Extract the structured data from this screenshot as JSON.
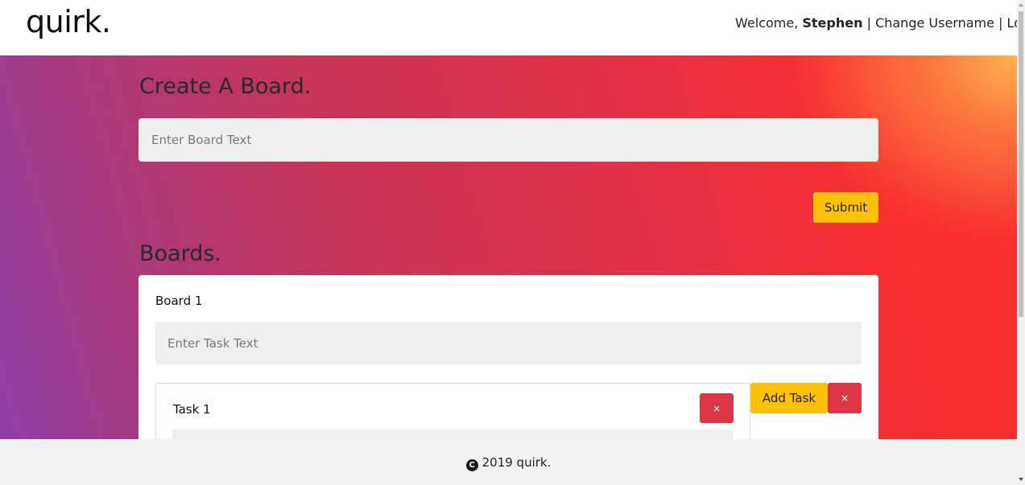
{
  "navbar": {
    "brand": "quirk.",
    "welcome_prefix": "Welcome,",
    "username": "Stephen",
    "separator": "|",
    "change_username": "Change Username",
    "logout": "Logout"
  },
  "create": {
    "heading": "Create A Board.",
    "input_placeholder": "Enter Board Text",
    "submit_label": "Submit"
  },
  "boards": {
    "heading": "Boards.",
    "items": [
      {
        "title": "Board 1",
        "task_placeholder": "Enter Task Text",
        "add_task_label": "Add Task",
        "delete_label": "×",
        "tasks": [
          {
            "title": "Task 1",
            "delete_label": "×"
          }
        ]
      }
    ]
  },
  "footer": {
    "copyright_icon": "copyright-icon",
    "copyright_symbol": "C",
    "text": "2019 quirk."
  },
  "colors": {
    "accent_yellow": "#ffc107",
    "danger_red": "#dc3545",
    "gradient_left": "#8f3ea8",
    "gradient_right": "#f72f2f",
    "gradient_corner": "#ffb44e"
  }
}
